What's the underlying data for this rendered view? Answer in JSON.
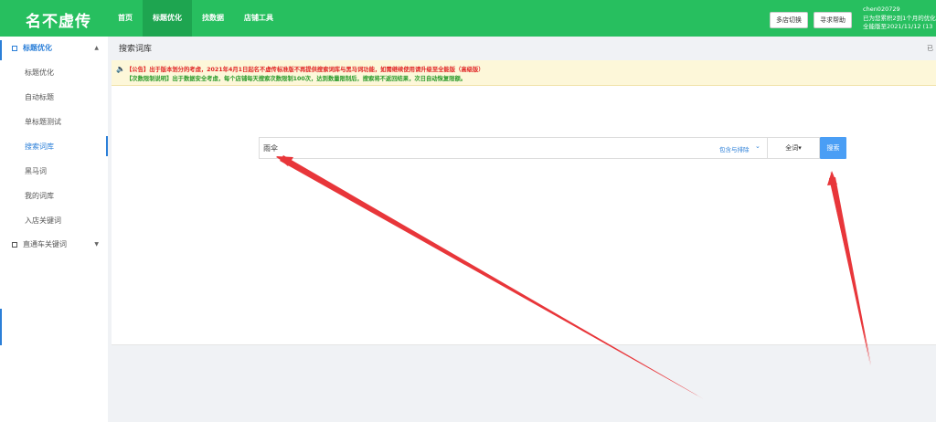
{
  "app": {
    "logo": "名不虚传"
  },
  "nav": {
    "items": [
      "首页",
      "标题优化",
      "找数据",
      "店铺工具"
    ],
    "active": "标题优化"
  },
  "topbar": {
    "multi_store_label": "多店切换",
    "help_label": "寻求帮助",
    "username": "chen020729",
    "order_info": "已为您累积2到1个月的优化",
    "version_info": "全能版至2021/11/12 (13"
  },
  "sidebar": {
    "group1": {
      "label": "标题优化",
      "chevron": "▲"
    },
    "items": [
      "标题优化",
      "自动标题",
      "单标题测试",
      "搜索词库",
      "黑马词",
      "我的词库",
      "入店关键词"
    ],
    "active": "搜索词库",
    "group2": {
      "label": "直通车关键词",
      "chevron": "▼"
    }
  },
  "page": {
    "title": "搜索词库",
    "right_hint": "已"
  },
  "notice": {
    "line1": "【公告】出于版本划分的考虑，2021年4月1日起名不虚传标准版不再提供搜索词库与黑马词功能，如需继续使用请升级至全能版（高级版）",
    "line2": "【次数限制说明】出于数据安全考虑，每个店铺每天搜索次数限制100次，达到数量限制后，搜索将不返回结果，次日自动恢复限额。"
  },
  "search": {
    "value": "雨伞",
    "include_exclude_label": "包含与排除",
    "match_label": "全词▾",
    "button_label": "搜索"
  },
  "colors": {
    "brand_green": "#27bf5f",
    "accent_blue": "#2b7fd8",
    "search_button": "#4a9ef5",
    "annotation_red": "#e8363a"
  }
}
